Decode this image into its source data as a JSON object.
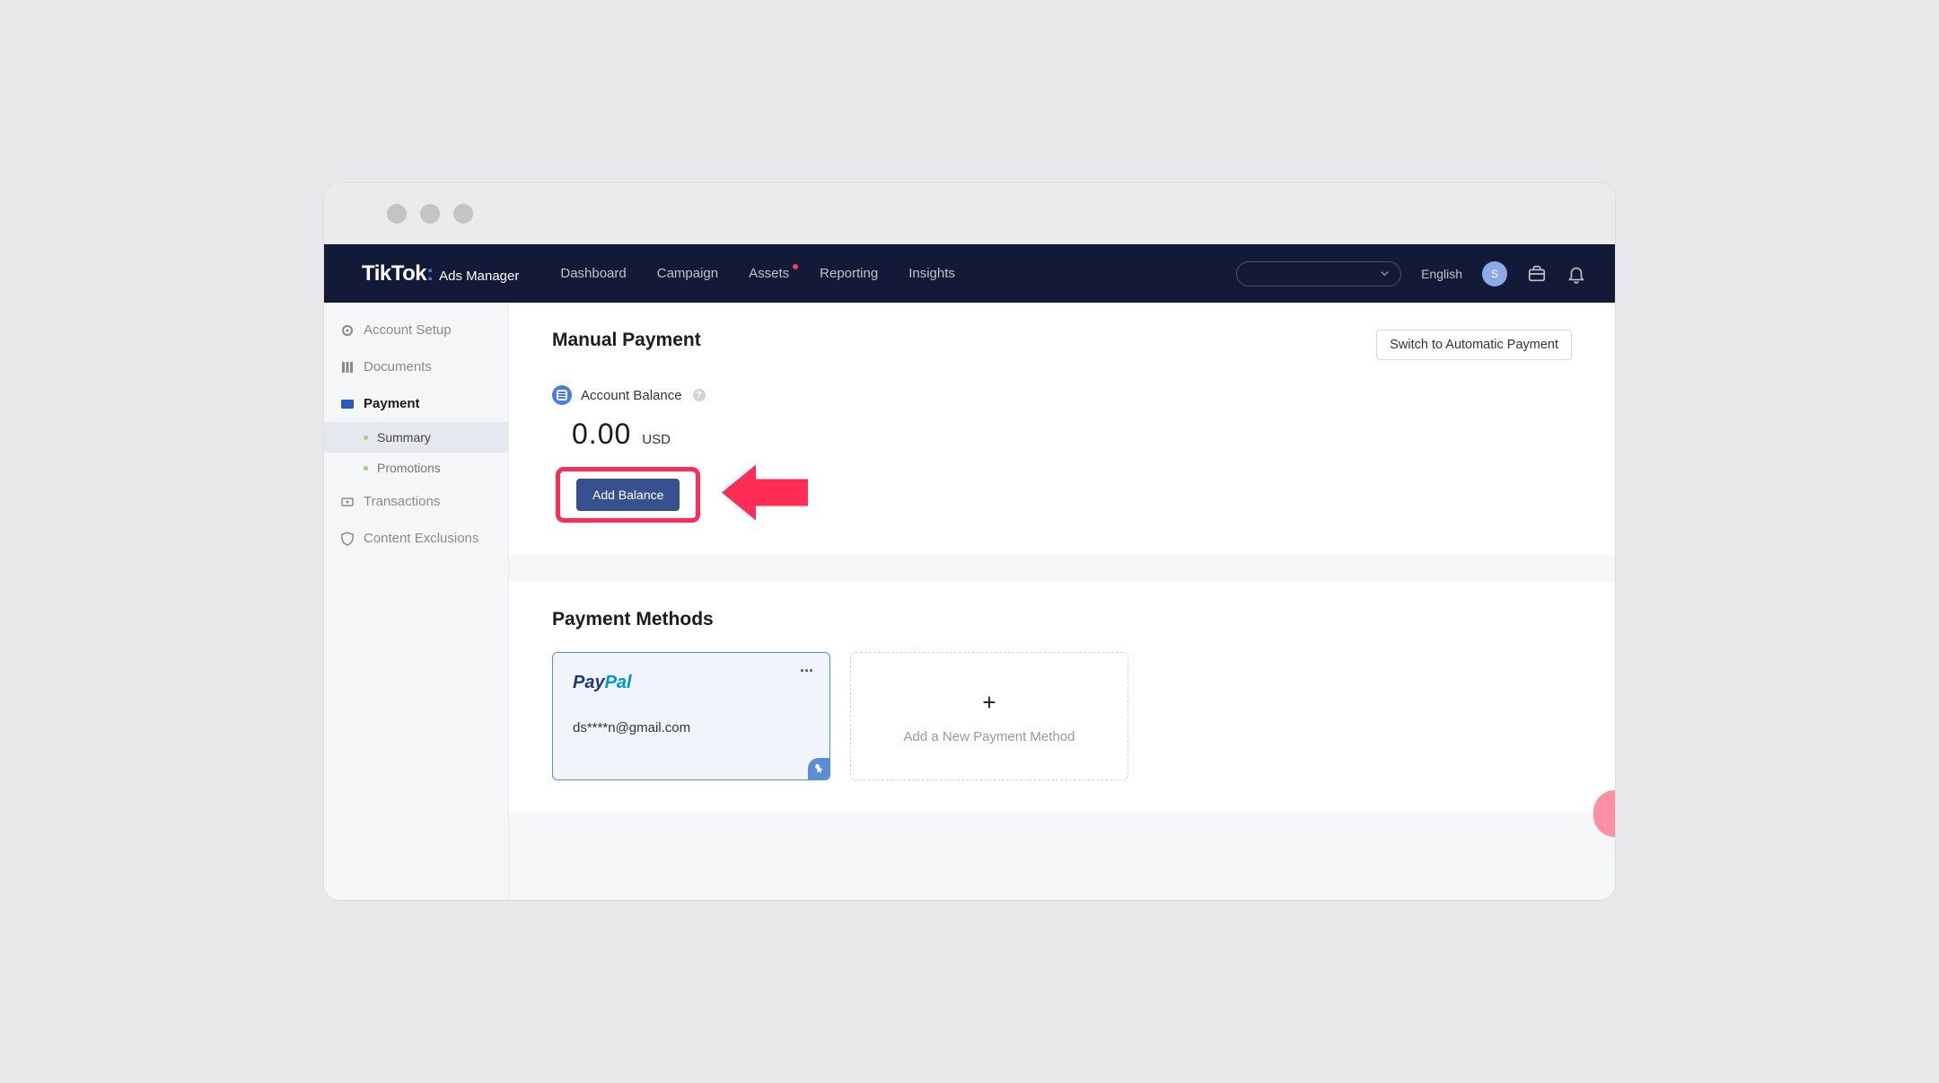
{
  "logo": {
    "main": "TikTok",
    "sub": "Ads Manager"
  },
  "nav": {
    "items": [
      "Dashboard",
      "Campaign",
      "Assets",
      "Reporting",
      "Insights"
    ],
    "notification_index": 2
  },
  "topbar": {
    "language": "English",
    "avatar_initial": "S"
  },
  "sidebar": {
    "items": [
      {
        "label": "Account Setup",
        "active": false
      },
      {
        "label": "Documents",
        "active": false
      },
      {
        "label": "Payment",
        "active": true
      },
      {
        "label": "Transactions",
        "active": false
      },
      {
        "label": "Content Exclusions",
        "active": false
      }
    ],
    "subitems": [
      {
        "label": "Summary",
        "selected": true
      },
      {
        "label": "Promotions",
        "selected": false
      }
    ]
  },
  "main": {
    "title": "Manual Payment",
    "switch_button": "Switch to Automatic Payment",
    "balance": {
      "label": "Account Balance",
      "amount": "0.00",
      "currency": "USD",
      "add_button": "Add Balance"
    },
    "payment_methods": {
      "title": "Payment Methods",
      "paypal_email": "ds****n@gmail.com",
      "add_label": "Add a New Payment Method"
    }
  }
}
